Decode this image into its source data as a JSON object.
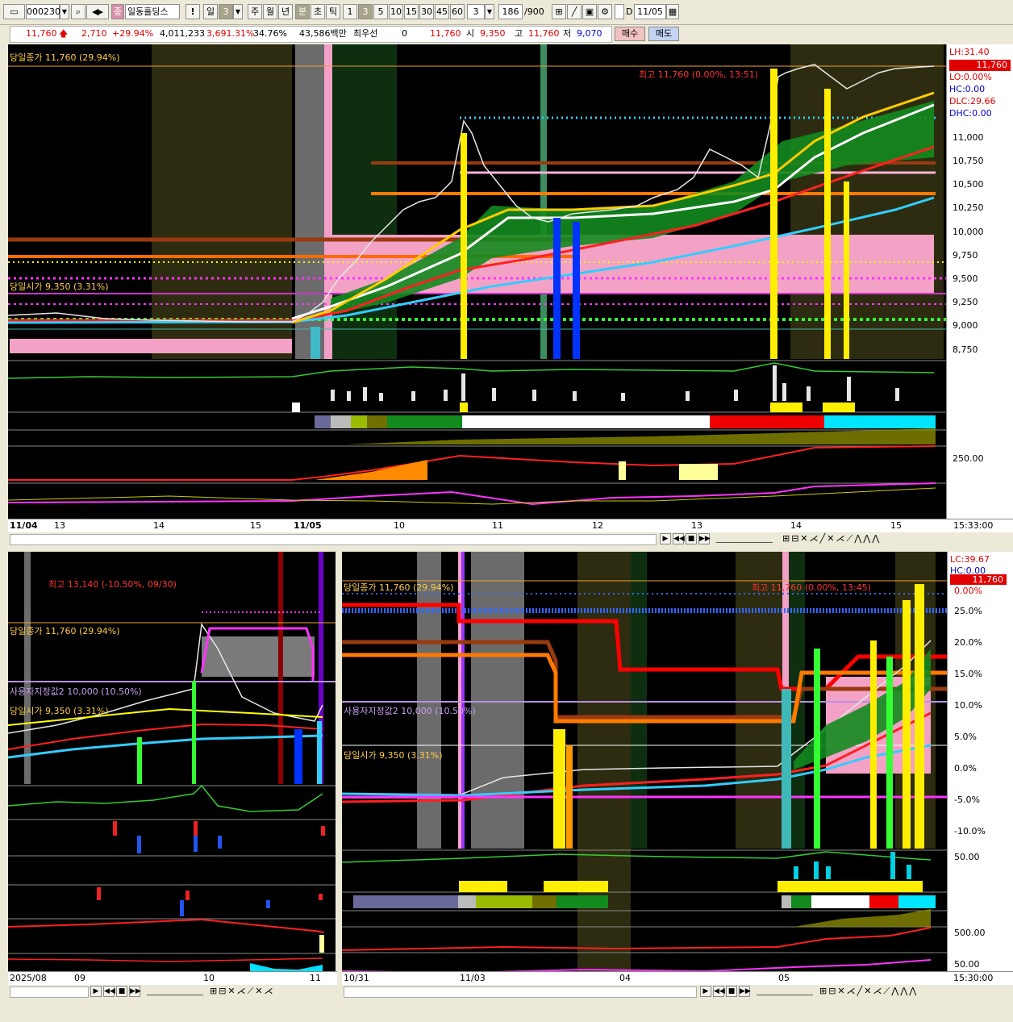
{
  "toolbar": {
    "code": "000230",
    "mark": "종",
    "name": "일동홀딩스",
    "excl": "!",
    "period_day": "일",
    "period_num": "3",
    "periods": [
      "주",
      "월",
      "년",
      "분",
      "초",
      "틱"
    ],
    "minutes": [
      "1",
      "3",
      "5",
      "10",
      "15",
      "30",
      "45",
      "60"
    ],
    "custom_num": "3",
    "count": "186",
    "count_total": "/900",
    "d_label": "D",
    "date": "11/05"
  },
  "quote": {
    "price": "11,760",
    "change": "2,710",
    "change_pct": "+29.94%",
    "volume": "4,011,233",
    "volume_ratio": "3,691.31%",
    "turnover": "34.76%",
    "amount": "43,586백만",
    "pref_label": "최우선",
    "pref_value": "0",
    "ask": "11,760",
    "open_label": "시",
    "open": "9,350",
    "high_label": "고",
    "high": "11,760",
    "low_label": "저",
    "low": "9,070",
    "buy": "매수",
    "sell": "매도"
  },
  "top_chart": {
    "close_label": "당일종가 11,760 (29.94%)",
    "open_label": "당일시가 9,350 (3.31%)",
    "high_note": "최고 11,760 (0.00%, 13:51)",
    "right_labels": {
      "lh": "LH:31.40",
      "price": "11,760",
      "lo": "LO:0.00%",
      "hc": "HC:0.00",
      "dlc": "DLC:29.66",
      "dhc": "DHC:0.00"
    },
    "y_ticks": [
      "11,000",
      "10,750",
      "10,500",
      "10,250",
      "10,000",
      "9,750",
      "9,500",
      "9,250",
      "9,000",
      "8,750"
    ],
    "sub_tick": "250.00",
    "x_labels": [
      "11/04",
      "13",
      "14",
      "15",
      "11/05",
      "10",
      "11",
      "12",
      "13",
      "14",
      "15"
    ],
    "time": "15:33:00"
  },
  "bottom_left": {
    "high_note": "최고 13,140 (-10.50%, 09/30)",
    "close_label": "당일종가 11,760 (29.94%)",
    "user_label": "사용자지정값2 10,000 (10.50%)",
    "open_label": "당일시가 9,350 (3.31%)",
    "x_labels": [
      "2025/08",
      "09",
      "10",
      "11"
    ]
  },
  "bottom_right": {
    "close_label": "당일종가 11,760 (29.94%)",
    "high_note": "최고 11,760 (0.00%, 13:45)",
    "user_label": "사용자지정값2 10,000 (10.50%)",
    "open_label": "당일시가 9,350 (3.31%)",
    "right_labels": {
      "lc": "LC:39.67",
      "hc": "HC:0.00",
      "price": "11,760",
      "pct": "0.00%"
    },
    "y_ticks": [
      "25.0%",
      "20.0%",
      "15.0%",
      "10.0%",
      "5.0%",
      "0.0%",
      "-5.0%",
      "-10.0%"
    ],
    "sub_ticks": [
      "50.00",
      "500.00",
      "50.00"
    ],
    "x_labels": [
      "10/31",
      "11/03",
      "04",
      "05"
    ],
    "time": "15:30:00"
  },
  "chart_data": [
    {
      "type": "candlestick",
      "title": "일동홀딩스 3분봉",
      "x": [
        "11/04",
        "13",
        "14",
        "15",
        "11/05",
        "10",
        "11",
        "12",
        "13",
        "14",
        "15"
      ],
      "ylim": [
        8700,
        11800
      ],
      "close": [
        9070,
        9060,
        9050,
        9080,
        9350,
        10050,
        10300,
        10250,
        10350,
        11760,
        11760
      ],
      "annotations": [
        "당일종가 11,760 (29.94%)",
        "당일시가 9,350 (3.31%)",
        "최고 11,760 (0.00%, 13:51)"
      ]
    },
    {
      "type": "candlestick",
      "x": [
        "2025/08",
        "09",
        "10",
        "11"
      ],
      "annotations": [
        "최고 13,140 (-10.50%, 09/30)",
        "사용자지정값2 10,000 (10.50%)"
      ]
    },
    {
      "type": "candlestick",
      "x": [
        "10/31",
        "11/03",
        "04",
        "05"
      ],
      "ylim": [
        -12,
        28
      ],
      "y_unit": "%"
    }
  ]
}
